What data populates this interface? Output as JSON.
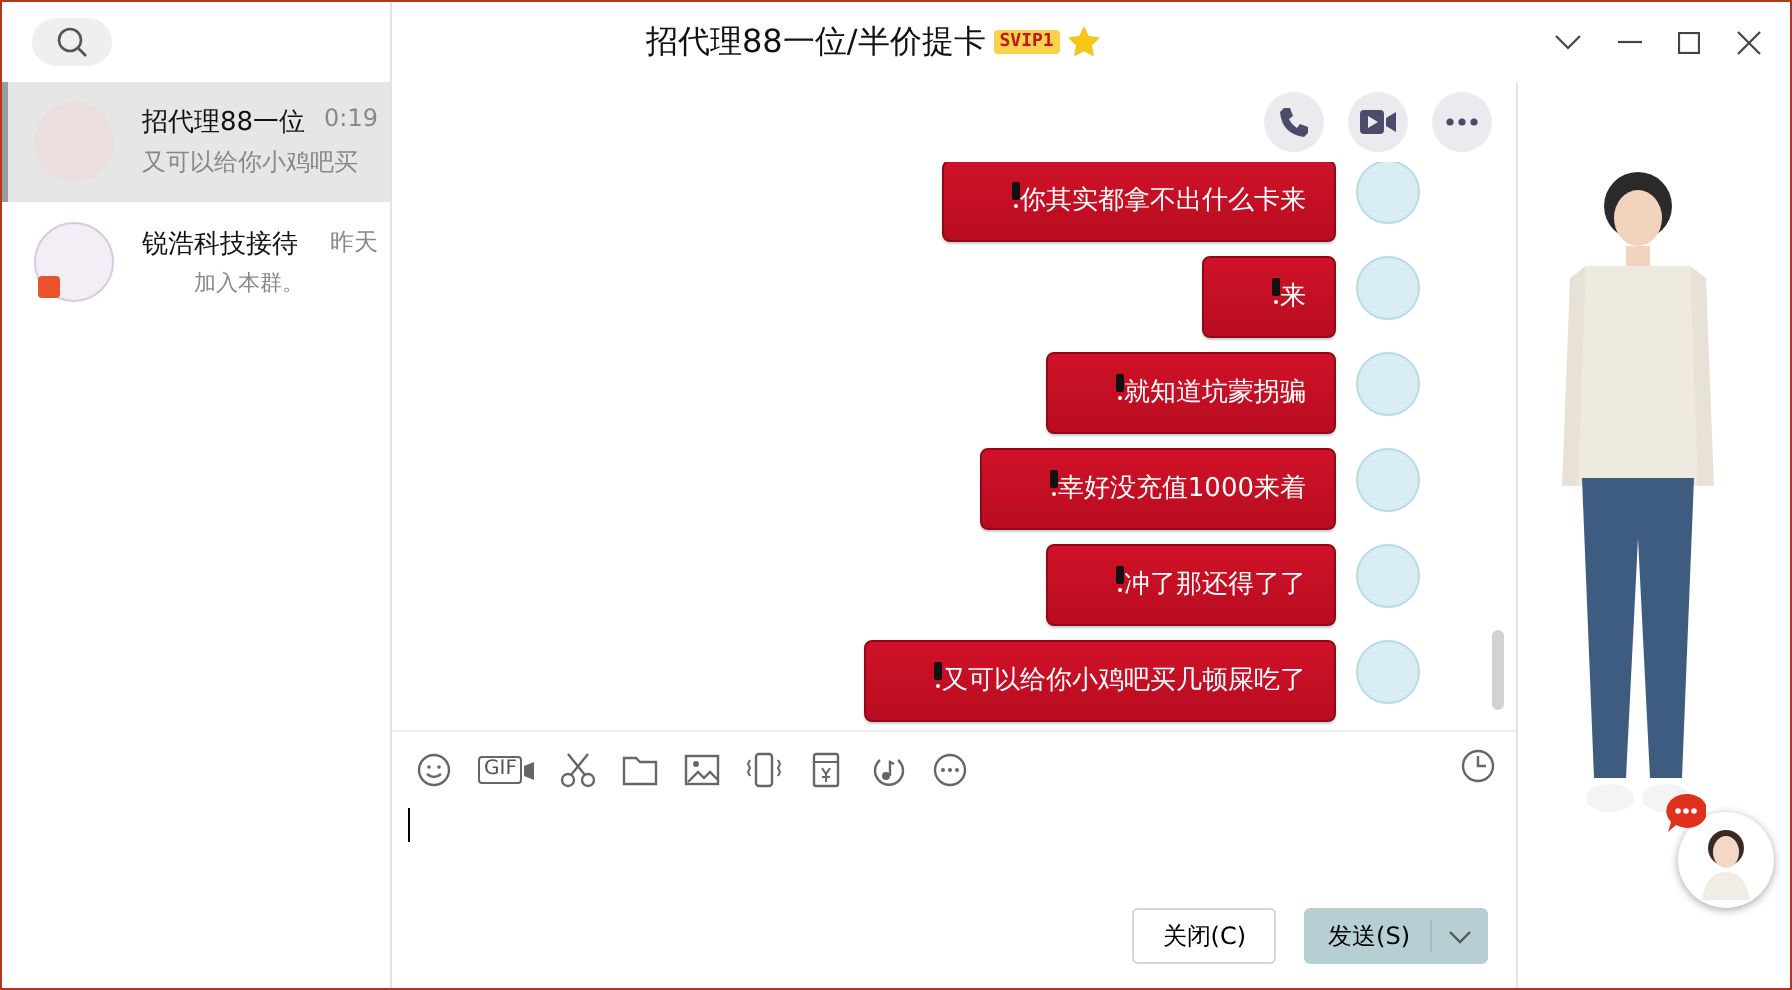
{
  "window": {
    "title": "招代理88一位/半价提卡",
    "badge": "SVIP1"
  },
  "conversations": [
    {
      "name": "招代理88一位",
      "time": "0:19",
      "preview": "又可以给你小鸡吧买",
      "selected": true
    },
    {
      "name": "锐浩科技接待",
      "time": "昨天",
      "preview": "加入本群。",
      "selected": false
    }
  ],
  "messages": [
    {
      "text": "你其实都拿不出什么卡来"
    },
    {
      "text": "来"
    },
    {
      "text": "就知道坑蒙拐骗"
    },
    {
      "text": "幸好没充值1000来着"
    },
    {
      "text": "冲了那还得了了"
    },
    {
      "text": "又可以给你小鸡吧买几顿屎吃了"
    }
  ],
  "toolbar": {
    "gif_label": "GIF"
  },
  "buttons": {
    "close": "关闭(C)",
    "send": "发送(S)"
  }
}
